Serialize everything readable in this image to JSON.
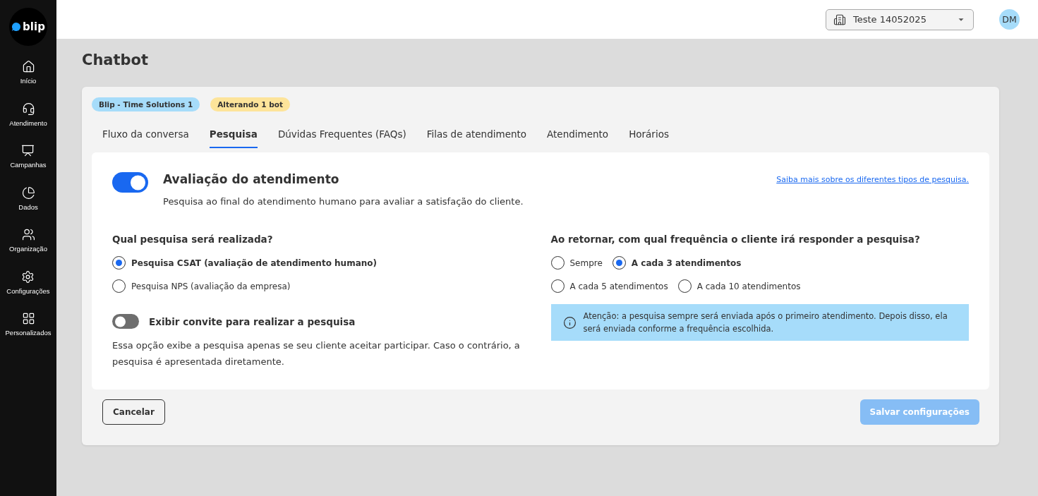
{
  "sidebar": {
    "logo": "blip",
    "items": [
      {
        "label": "Início"
      },
      {
        "label": "Atendimento"
      },
      {
        "label": "Campanhas"
      },
      {
        "label": "Dados"
      },
      {
        "label": "Organização"
      },
      {
        "label": "Configurações"
      },
      {
        "label": "Personalizados"
      }
    ]
  },
  "topbar": {
    "workspace": "Teste 14052025",
    "avatar": "DM"
  },
  "page_title": "Chatbot",
  "badges": [
    {
      "text": "Blip - Time Solutions 1",
      "color": "#a6dcfa"
    },
    {
      "text": "Alterando 1 bot",
      "color": "#fde49a"
    }
  ],
  "tabs": [
    {
      "label": "Fluxo da conversa",
      "selected": false
    },
    {
      "label": "Pesquisa",
      "selected": true
    },
    {
      "label": "Dúvidas Frequentes (FAQs)",
      "selected": false
    },
    {
      "label": "Filas de atendimento",
      "selected": false
    },
    {
      "label": "Atendimento",
      "selected": false
    },
    {
      "label": "Horários",
      "selected": false
    }
  ],
  "survey": {
    "on": true,
    "title": "Avaliação do atendimento",
    "description": "Pesquisa ao final do atendimento humano para avaliar a satisfação do cliente.",
    "link": "Saiba mais sobre os diferentes tipos de pesquisa."
  },
  "survey_type": {
    "question": "Qual pesquisa será realizada?",
    "options": [
      {
        "label": "Pesquisa CSAT (avaliação de atendimento humano)",
        "selected": true
      },
      {
        "label": "Pesquisa NPS (avaliação da empresa)",
        "selected": false
      }
    ]
  },
  "invite": {
    "on": false,
    "label": "Exibir convite para realizar a pesquisa",
    "description": "Essa opção exibe a pesquisa apenas se seu cliente aceitar participar. Caso o contrário, a pesquisa é apresentada diretamente."
  },
  "frequency": {
    "question": "Ao retornar, com qual frequência o cliente irá responder a pesquisa?",
    "options": [
      {
        "label": "Sempre",
        "selected": false
      },
      {
        "label": "A cada 3 atendimentos",
        "selected": true
      },
      {
        "label": "A cada 5 atendimentos",
        "selected": false
      },
      {
        "label": "A cada 10 atendimentos",
        "selected": false
      }
    ],
    "notice": "Atenção: a pesquisa sempre será enviada após o primeiro atendimento. Depois disso, ela será enviada conforme a frequência escolhida."
  },
  "buttons": {
    "cancel": {
      "label": "Cancelar"
    },
    "save": {
      "label": "Salvar configurações",
      "disabled": true
    }
  }
}
